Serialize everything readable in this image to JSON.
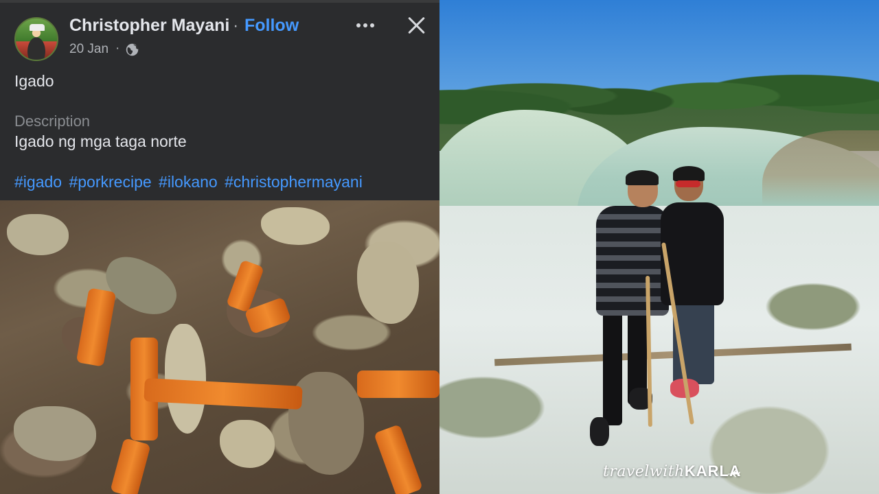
{
  "post": {
    "author": "Christopher Mayani",
    "separator": "·",
    "follow_label": "Follow",
    "date": "20 Jan",
    "date_separator": "·",
    "visibility_icon": "globe-icon",
    "more_icon": "more-options-icon",
    "close_icon": "close-icon",
    "caption": "Igado",
    "description_label": "Description",
    "description_text": "Igado ng mga taga norte",
    "hashtags": [
      "#igado",
      "#porkrecipe",
      "#ilokano",
      "#christophermayani"
    ]
  },
  "right_photo": {
    "watermark_script": "travelwith",
    "watermark_bold": "KARLA",
    "watermark_icon": "airplane-icon"
  },
  "colors": {
    "link_blue": "#4599ff",
    "post_background": "#2b2c2e",
    "text_primary": "#e4e6eb",
    "text_secondary": "#b0b3b8"
  }
}
